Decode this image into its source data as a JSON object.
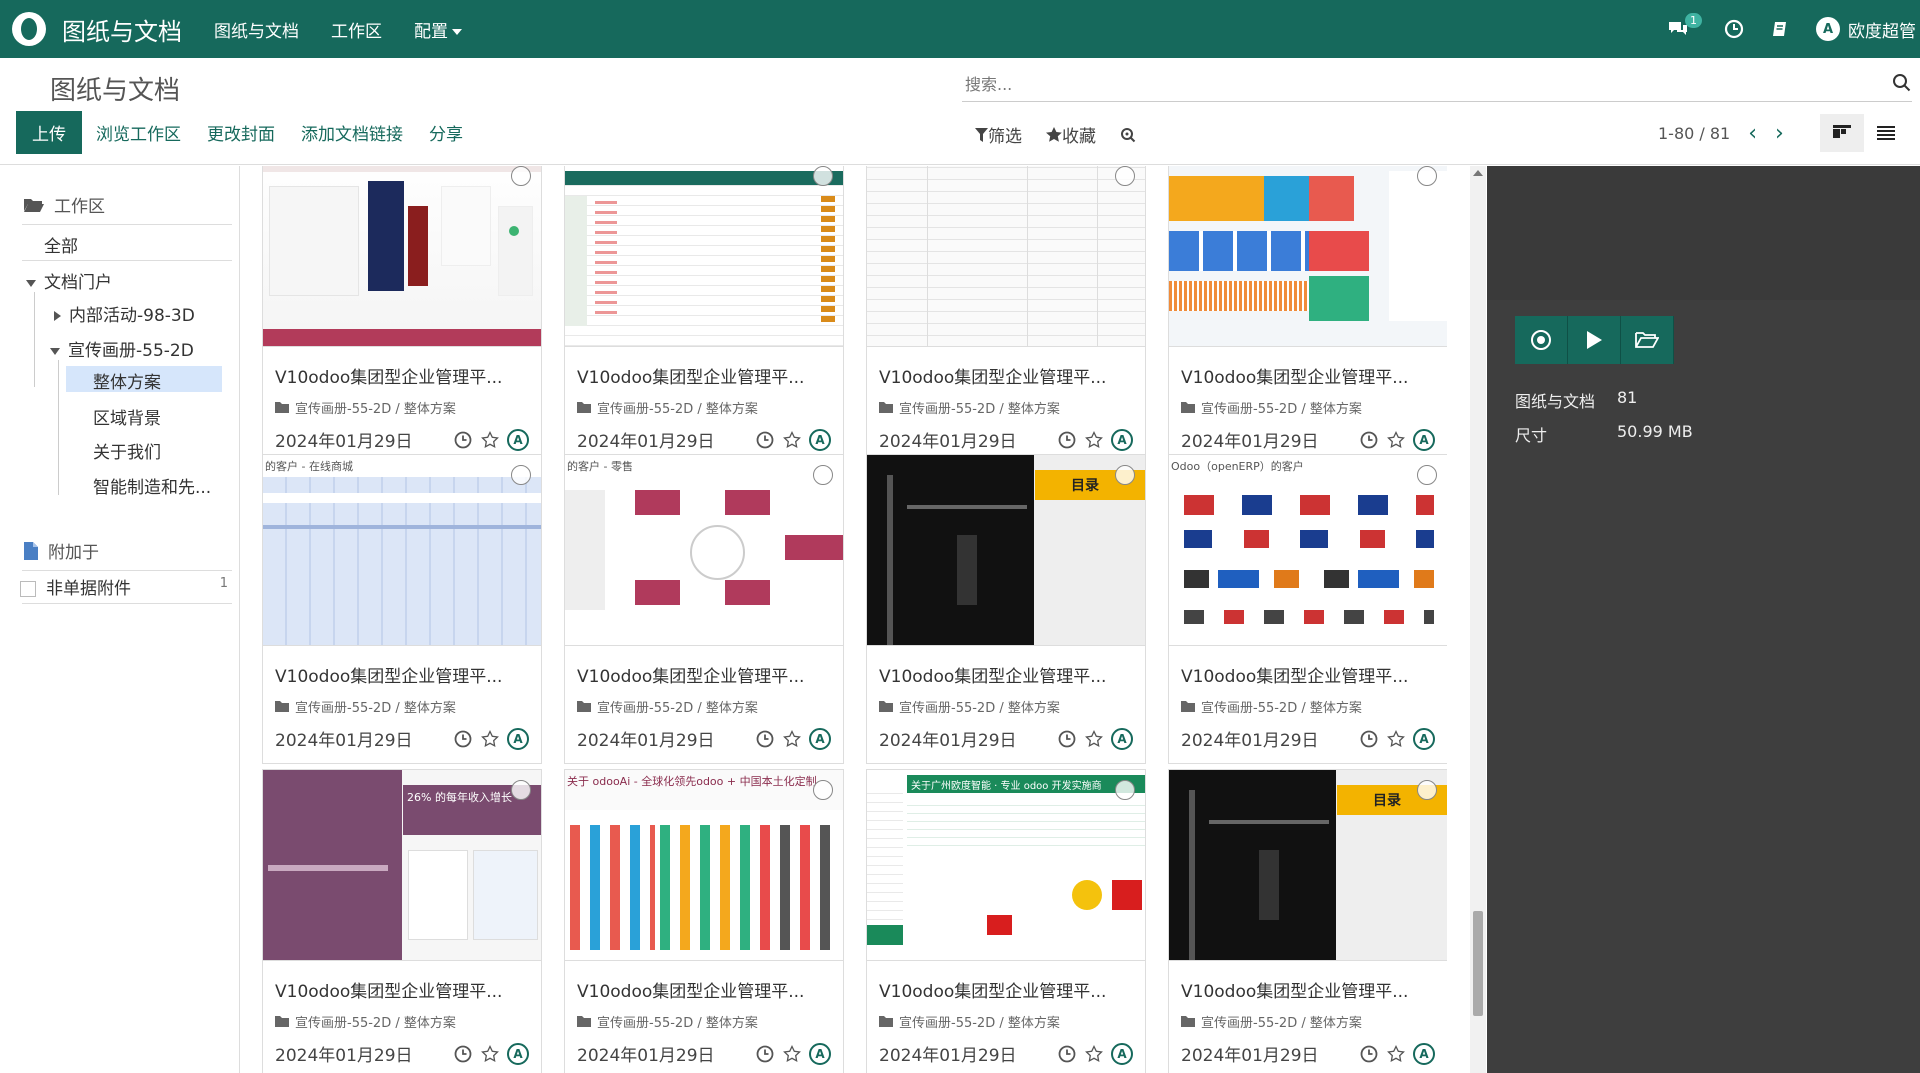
{
  "app": {
    "brand": "图纸与文档",
    "menu": [
      "图纸与文档",
      "工作区",
      "配置"
    ],
    "messages_badge": "1",
    "user": "欧度超管",
    "user_avatar_letter": "A"
  },
  "control_panel": {
    "title": "图纸与文档",
    "search_placeholder": "搜索...",
    "buttons": {
      "upload": "上传",
      "browse": "浏览工作区",
      "cover": "更改封面",
      "add_link": "添加文档链接",
      "share": "分享"
    },
    "filters": {
      "filter": "筛选",
      "favorites": "收藏"
    },
    "pager": "1-80 / 81"
  },
  "sidebar": {
    "workspace_header": "工作区",
    "all": "全部",
    "portal": "文档门户",
    "internal": "内部活动-98-3D",
    "brochure": "宣传画册-55-2D",
    "children": [
      "整体方案",
      "区域背景",
      "关于我们",
      "智能制造和先..."
    ],
    "attached_header": "附加于",
    "non_doc": "非单据附件",
    "non_doc_count": "1"
  },
  "cards": [
    {
      "title": "V10odoo集团型企业管理平...",
      "folder": "宣传画册-55-2D / 整体方案",
      "date": "2024年01月29日"
    },
    {
      "title": "V10odoo集团型企业管理平...",
      "folder": "宣传画册-55-2D / 整体方案",
      "date": "2024年01月29日"
    },
    {
      "title": "V10odoo集团型企业管理平...",
      "folder": "宣传画册-55-2D / 整体方案",
      "date": "2024年01月29日"
    },
    {
      "title": "V10odoo集团型企业管理平...",
      "folder": "宣传画册-55-2D / 整体方案",
      "date": "2024年01月29日"
    },
    {
      "title": "V10odoo集团型企业管理平...",
      "folder": "宣传画册-55-2D / 整体方案",
      "date": "2024年01月29日"
    },
    {
      "title": "V10odoo集团型企业管理平...",
      "folder": "宣传画册-55-2D / 整体方案",
      "date": "2024年01月29日"
    },
    {
      "title": "V10odoo集团型企业管理平...",
      "folder": "宣传画册-55-2D / 整体方案",
      "date": "2024年01月29日"
    },
    {
      "title": "V10odoo集团型企业管理平...",
      "folder": "宣传画册-55-2D / 整体方案",
      "date": "2024年01月29日"
    },
    {
      "title": "V10odoo集团型企业管理平...",
      "folder": "宣传画册-55-2D / 整体方案",
      "date": "2024年01月29日"
    },
    {
      "title": "V10odoo集团型企业管理平...",
      "folder": "宣传画册-55-2D / 整体方案",
      "date": "2024年01月29日"
    },
    {
      "title": "V10odoo集团型企业管理平...",
      "folder": "宣传画册-55-2D / 整体方案",
      "date": "2024年01月29日"
    },
    {
      "title": "V10odoo集团型企业管理平...",
      "folder": "宣传画册-55-2D / 整体方案",
      "date": "2024年01月29日"
    }
  ],
  "thumb_texts": {
    "t5": "的客户 - 在线商城",
    "t6": "的客户 - 零售",
    "t7": "目录",
    "t8": "Odoo（openERP）的客户",
    "t9": "26% 的每年收入增长",
    "t10": "关于 odooAi - 全球化领先odoo + 中国本土化定制",
    "t11": "关于广州欧度智能 · 专业 odoo 开发实施商",
    "t12": "目录"
  },
  "right_panel": {
    "docs_label": "图纸与文档",
    "docs_count": "81",
    "size_label": "尺寸",
    "size_value": "50.99 MB"
  },
  "colors": {
    "primary": "#16695c",
    "selected": "#d6e6fb",
    "panel_dark": "#3e3e3e"
  }
}
